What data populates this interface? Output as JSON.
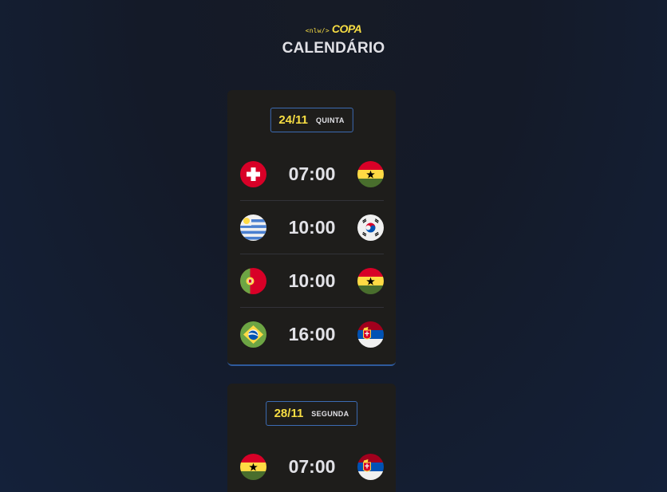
{
  "header": {
    "logo_tag": "<nlw/>",
    "logo_text": "COPA",
    "title": "CALENDÁRIO"
  },
  "colors": {
    "accent_yellow": "#f7dd43",
    "card_bg": "#1e1d1b",
    "border_blue": "#3c6bb3"
  },
  "cards": [
    {
      "date": "24/11",
      "weekday": "QUINTA",
      "matches": [
        {
          "home_flag": "switzerland-flag-icon",
          "time": "07:00",
          "away_flag": "ghana-flag-icon"
        },
        {
          "home_flag": "uruguay-flag-icon",
          "time": "10:00",
          "away_flag": "south-korea-flag-icon"
        },
        {
          "home_flag": "portugal-flag-icon",
          "time": "10:00",
          "away_flag": "ghana-flag-icon"
        },
        {
          "home_flag": "brazil-flag-icon",
          "time": "16:00",
          "away_flag": "serbia-flag-icon"
        }
      ]
    },
    {
      "date": "28/11",
      "weekday": "SEGUNDA",
      "matches": [
        {
          "home_flag": "ghana-flag-icon",
          "time": "07:00",
          "away_flag": "serbia-flag-icon"
        }
      ]
    }
  ]
}
